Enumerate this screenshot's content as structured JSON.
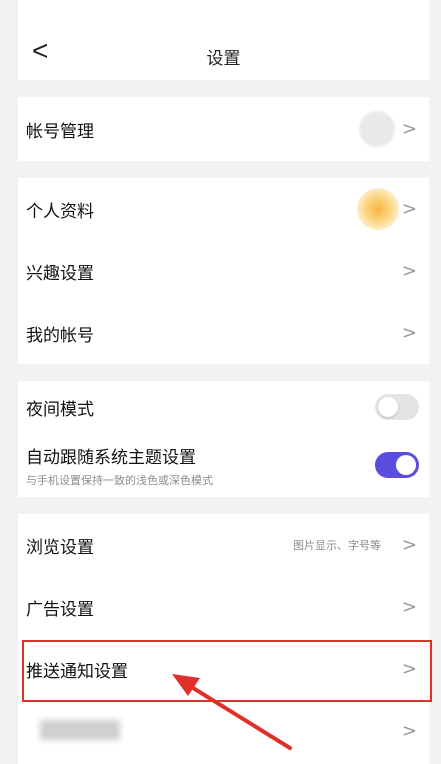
{
  "header": {
    "title": "设置",
    "back_glyph": "<"
  },
  "groups": {
    "account": {
      "label": "帐号管理"
    },
    "profile": {
      "label": "个人资料"
    },
    "interests": {
      "label": "兴趣设置"
    },
    "my_account": {
      "label": "我的帐号"
    },
    "night_mode": {
      "label": "夜间模式",
      "on": false
    },
    "auto_theme": {
      "label": "自动跟随系统主题设置",
      "subtitle": "与手机设置保持一致的浅色或深色模式",
      "on": true
    },
    "browse": {
      "label": "浏览设置",
      "hint": "图片显示、字号等"
    },
    "ads": {
      "label": "广告设置"
    },
    "push": {
      "label": "推送通知设置"
    }
  },
  "chevron": ">",
  "colors": {
    "accent": "#5b4de0",
    "highlight": "#e0302a",
    "avatar": "#f6b544"
  },
  "icons": {
    "back": "chevron-left-icon",
    "row": "chevron-right-icon"
  }
}
